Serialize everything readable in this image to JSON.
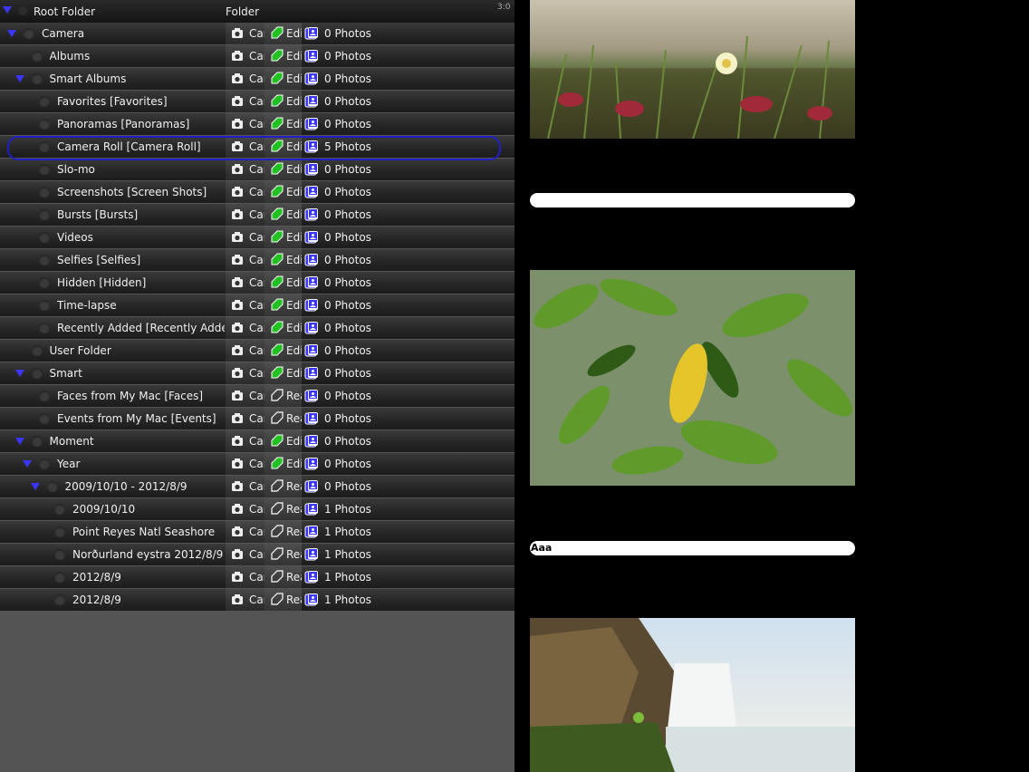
{
  "header": {
    "title": "Root Folder",
    "column_label": "Folder",
    "status": "3:0"
  },
  "rows": [
    {
      "name": "Camera",
      "indent": 0,
      "expanded": true,
      "cam": "Camera",
      "edit": "Edit",
      "edit_kind": "edit",
      "photos": "0 Photos"
    },
    {
      "name": "Albums",
      "indent": 1,
      "expanded": false,
      "cam": "Camera",
      "edit": "Edit",
      "edit_kind": "edit",
      "photos": "0 Photos"
    },
    {
      "name": "Smart Albums",
      "indent": 1,
      "expanded": true,
      "cam": "Camera",
      "edit": "Edit",
      "edit_kind": "edit",
      "photos": "0 Photos"
    },
    {
      "name": "Favorites  [Favorites]",
      "indent": 2,
      "expanded": false,
      "cam": "Camera",
      "edit": "Edit",
      "edit_kind": "edit",
      "photos": "0 Photos"
    },
    {
      "name": "Panoramas  [Panoramas]",
      "indent": 2,
      "expanded": false,
      "cam": "Camera",
      "edit": "Edit",
      "edit_kind": "edit",
      "photos": "0 Photos"
    },
    {
      "name": "Camera Roll  [Camera Roll]",
      "indent": 2,
      "expanded": false,
      "cam": "Camera",
      "edit": "Edit",
      "edit_kind": "edit",
      "photos": "5 Photos",
      "selected": true
    },
    {
      "name": "Slo-mo",
      "indent": 2,
      "expanded": false,
      "cam": "Camera",
      "edit": "Edit",
      "edit_kind": "edit",
      "photos": "0 Photos"
    },
    {
      "name": "Screenshots  [Screen Shots]",
      "indent": 2,
      "expanded": false,
      "cam": "Camera",
      "edit": "Edit",
      "edit_kind": "edit",
      "photos": "0 Photos"
    },
    {
      "name": "Bursts  [Bursts]",
      "indent": 2,
      "expanded": false,
      "cam": "Camera",
      "edit": "Edit",
      "edit_kind": "edit",
      "photos": "0 Photos"
    },
    {
      "name": "Videos",
      "indent": 2,
      "expanded": false,
      "cam": "Camera",
      "edit": "Edit",
      "edit_kind": "edit",
      "photos": "0 Photos"
    },
    {
      "name": "Selfies  [Selfies]",
      "indent": 2,
      "expanded": false,
      "cam": "Camera",
      "edit": "Edit",
      "edit_kind": "edit",
      "photos": "0 Photos"
    },
    {
      "name": "Hidden  [Hidden]",
      "indent": 2,
      "expanded": false,
      "cam": "Camera",
      "edit": "Edit",
      "edit_kind": "edit",
      "photos": "0 Photos"
    },
    {
      "name": "Time-lapse",
      "indent": 2,
      "expanded": false,
      "cam": "Camera",
      "edit": "Edit",
      "edit_kind": "edit",
      "photos": "0 Photos"
    },
    {
      "name": "Recently Added  [Recently Added]",
      "indent": 2,
      "expanded": false,
      "cam": "Camera",
      "edit": "Edit",
      "edit_kind": "edit",
      "photos": "0 Photos"
    },
    {
      "name": "User Folder",
      "indent": 1,
      "expanded": false,
      "cam": "Camera",
      "edit": "Edit",
      "edit_kind": "edit",
      "photos": "0 Photos"
    },
    {
      "name": "Smart",
      "indent": 1,
      "expanded": true,
      "cam": "Camera",
      "edit": "Edit",
      "edit_kind": "edit",
      "photos": "0 Photos"
    },
    {
      "name": "Faces from My Mac  [Faces]",
      "indent": 2,
      "expanded": false,
      "cam": "Camera",
      "edit": "Read",
      "edit_kind": "read",
      "photos": "0 Photos"
    },
    {
      "name": "Events from My Mac  [Events]",
      "indent": 2,
      "expanded": false,
      "cam": "Camera",
      "edit": "Read",
      "edit_kind": "read",
      "photos": "0 Photos"
    },
    {
      "name": "Moment",
      "indent": 1,
      "expanded": true,
      "cam": "Camera",
      "edit": "Edit",
      "edit_kind": "edit",
      "photos": "0 Photos"
    },
    {
      "name": "Year",
      "indent": 2,
      "expanded": true,
      "cam": "Camera",
      "edit": "Edit",
      "edit_kind": "edit",
      "photos": "0 Photos"
    },
    {
      "name": "2009/10/10 - 2012/8/9",
      "indent": 3,
      "expanded": true,
      "cam": "Camera",
      "edit": "Read",
      "edit_kind": "read",
      "photos": "0 Photos"
    },
    {
      "name": "2009/10/10",
      "indent": 4,
      "expanded": false,
      "cam": "Camera",
      "edit": "Read",
      "edit_kind": "read",
      "photos": "1 Photos"
    },
    {
      "name": "Point Reyes Natl Seashore",
      "indent": 4,
      "expanded": false,
      "cam": "Camera",
      "edit": "Read",
      "edit_kind": "read",
      "photos": "1 Photos"
    },
    {
      "name": "Norðurland eystra  2012/8/9 :",
      "indent": 4,
      "expanded": false,
      "cam": "Camera",
      "edit": "Read",
      "edit_kind": "read",
      "photos": "1 Photos"
    },
    {
      "name": "2012/8/9",
      "indent": 4,
      "expanded": false,
      "cam": "Camera",
      "edit": "Read",
      "edit_kind": "read",
      "photos": "1 Photos"
    },
    {
      "name": "2012/8/9",
      "indent": 4,
      "expanded": false,
      "cam": "Camera",
      "edit": "Read",
      "edit_kind": "read",
      "photos": "1 Photos"
    }
  ],
  "gallery": {
    "caption_1": "",
    "caption_2": "Aaa"
  },
  "colors": {
    "tree_triangle": "#3a36ff",
    "edit_icon": "#22c022",
    "photos_icon": "#3a36ff",
    "selection_ring": "#1f1fc8"
  },
  "icons": {
    "header_dot": "dot-icon",
    "camera": "camera-icon",
    "edit": "edit-tag-icon",
    "photos": "photos-icon"
  }
}
